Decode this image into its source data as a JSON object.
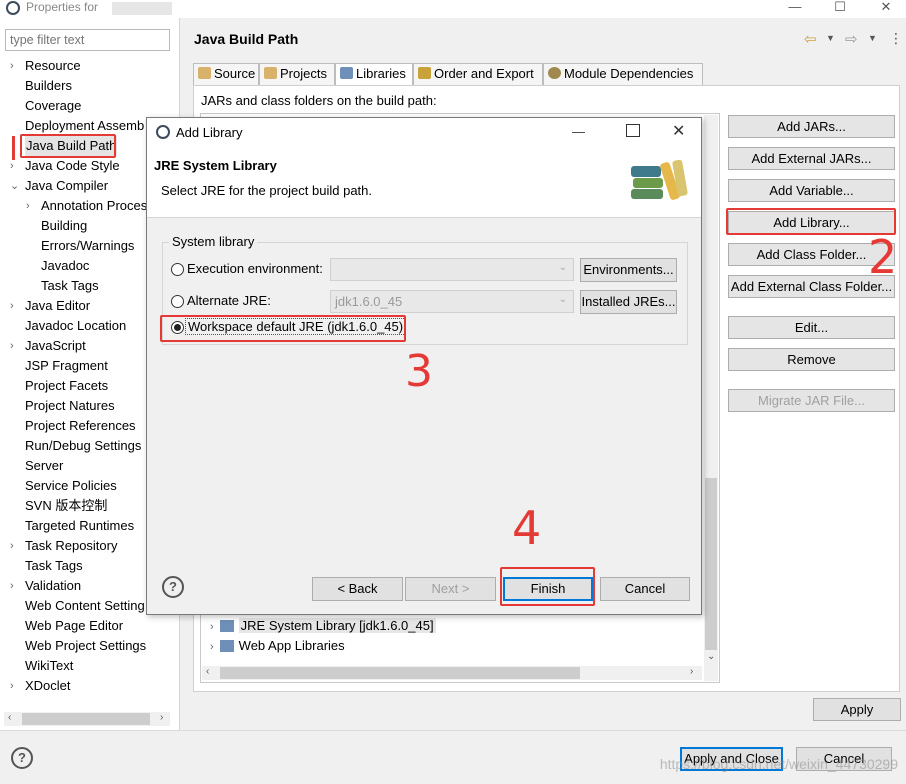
{
  "window": {
    "title": "Properties for",
    "minimize_glyph": "—",
    "maximize_glyph": "☐",
    "close_glyph": "✕"
  },
  "left": {
    "filter_placeholder": "type filter text",
    "items": [
      {
        "label": "Resource",
        "arrow": "›",
        "indent": 0
      },
      {
        "label": "Builders",
        "arrow": "",
        "indent": 0
      },
      {
        "label": "Coverage",
        "arrow": "",
        "indent": 0
      },
      {
        "label": "Deployment Assemb",
        "arrow": "",
        "indent": 0
      },
      {
        "label": "Java Build Path",
        "arrow": "",
        "indent": 0,
        "selected": true
      },
      {
        "label": "Java Code Style",
        "arrow": "›",
        "indent": 0
      },
      {
        "label": "Java Compiler",
        "arrow": "⌄",
        "indent": 0
      },
      {
        "label": "Annotation Proces",
        "arrow": "›",
        "indent": 1
      },
      {
        "label": "Building",
        "arrow": "",
        "indent": 1
      },
      {
        "label": "Errors/Warnings",
        "arrow": "",
        "indent": 1
      },
      {
        "label": "Javadoc",
        "arrow": "",
        "indent": 1
      },
      {
        "label": "Task Tags",
        "arrow": "",
        "indent": 1
      },
      {
        "label": "Java Editor",
        "arrow": "›",
        "indent": 0
      },
      {
        "label": "Javadoc Location",
        "arrow": "",
        "indent": 0
      },
      {
        "label": "JavaScript",
        "arrow": "›",
        "indent": 0
      },
      {
        "label": "JSP Fragment",
        "arrow": "",
        "indent": 0
      },
      {
        "label": "Project Facets",
        "arrow": "",
        "indent": 0
      },
      {
        "label": "Project Natures",
        "arrow": "",
        "indent": 0
      },
      {
        "label": "Project References",
        "arrow": "",
        "indent": 0
      },
      {
        "label": "Run/Debug Settings",
        "arrow": "",
        "indent": 0
      },
      {
        "label": "Server",
        "arrow": "",
        "indent": 0
      },
      {
        "label": "Service Policies",
        "arrow": "",
        "indent": 0
      },
      {
        "label": "SVN 版本控制",
        "arrow": "",
        "indent": 0
      },
      {
        "label": "Targeted Runtimes",
        "arrow": "",
        "indent": 0
      },
      {
        "label": "Task Repository",
        "arrow": "›",
        "indent": 0
      },
      {
        "label": "Task Tags",
        "arrow": "",
        "indent": 0
      },
      {
        "label": "Validation",
        "arrow": "›",
        "indent": 0
      },
      {
        "label": "Web Content Setting",
        "arrow": "",
        "indent": 0
      },
      {
        "label": "Web Page Editor",
        "arrow": "",
        "indent": 0
      },
      {
        "label": "Web Project Settings",
        "arrow": "",
        "indent": 0
      },
      {
        "label": "WikiText",
        "arrow": "",
        "indent": 0
      },
      {
        "label": "XDoclet",
        "arrow": "›",
        "indent": 0
      }
    ]
  },
  "main": {
    "heading": "Java Build Path",
    "tabs": [
      {
        "label": "Source",
        "active": false
      },
      {
        "label": "Projects",
        "active": false
      },
      {
        "label": "Libraries",
        "active": true
      },
      {
        "label": "Order and Export",
        "active": false
      },
      {
        "label": "Module Dependencies",
        "active": false
      }
    ],
    "jars_label": "JARs and class folders on the build path:",
    "libraries": [
      "JRE System Library [jdk1.6.0_45]",
      "Web App Libraries"
    ],
    "side_buttons": [
      {
        "label": "Add JARs...",
        "enabled": true
      },
      {
        "label": "Add External JARs...",
        "enabled": true
      },
      {
        "label": "Add Variable...",
        "enabled": true
      },
      {
        "label": "Add Library...",
        "enabled": true
      },
      {
        "label": "Add Class Folder...",
        "enabled": true
      },
      {
        "label": "Add External Class Folder...",
        "enabled": true
      },
      {
        "label": "Edit...",
        "enabled": true
      },
      {
        "label": "Remove",
        "enabled": true
      },
      {
        "label": "Migrate JAR File...",
        "enabled": false
      }
    ],
    "apply": "Apply",
    "apply_close": "Apply and Close",
    "cancel": "Cancel"
  },
  "dialog": {
    "title": "Add Library",
    "heading": "JRE System Library",
    "description": "Select JRE for the project build path.",
    "group_label": "System library",
    "options": [
      {
        "label": "Execution environment:",
        "checked": false,
        "combo": "",
        "button": "Environments..."
      },
      {
        "label": "Alternate JRE:",
        "checked": false,
        "combo": "jdk1.6.0_45",
        "button": "Installed JREs..."
      },
      {
        "label": "Workspace default JRE (jdk1.6.0_45)",
        "checked": true
      }
    ],
    "back": "< Back",
    "next": "Next >",
    "finish": "Finish",
    "cancel": "Cancel",
    "help_glyph": "?"
  },
  "annotations": {
    "mark_2": "2",
    "mark_3": "3",
    "mark_4": "4",
    "color": "#e53935"
  },
  "watermark": "https://blog.csdn.net/weixin_44730299"
}
